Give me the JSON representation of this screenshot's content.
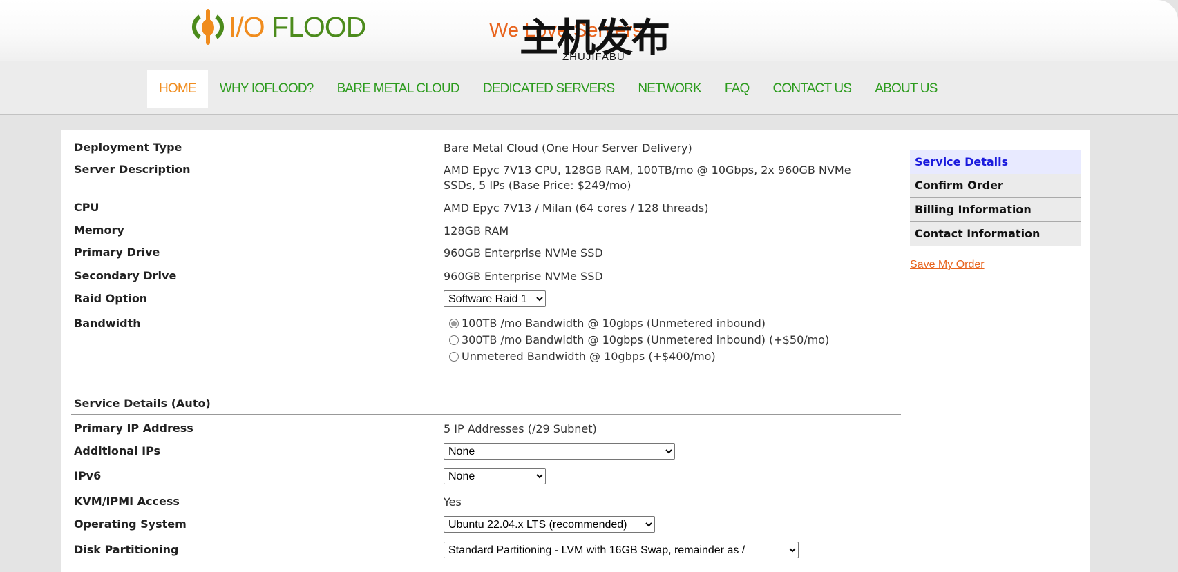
{
  "header": {
    "logo_text_io": "I/O",
    "logo_text_flood": " FLOOD",
    "tagline": "We Love Servers",
    "watermark_cn": "主机发布",
    "watermark_en": "ZHUJIFABU"
  },
  "nav": {
    "items": [
      "HOME",
      "WHY IOFLOOD?",
      "BARE METAL CLOUD",
      "DEDICATED SERVERS",
      "NETWORK",
      "FAQ",
      "CONTACT US",
      "ABOUT US"
    ],
    "active": "HOME"
  },
  "details": {
    "deployment_type": {
      "label": "Deployment Type",
      "value": "Bare Metal Cloud (One Hour Server Delivery)"
    },
    "server_description": {
      "label": "Server Description",
      "value": "AMD Epyc 7V13 CPU, 128GB RAM, 100TB/mo @ 10Gbps, 2x 960GB NVMe SSDs, 5 IPs (Base Price: $249/mo)"
    },
    "cpu": {
      "label": "CPU",
      "value": "AMD Epyc 7V13 / Milan (64 cores / 128 threads)"
    },
    "memory": {
      "label": "Memory",
      "value": "128GB RAM"
    },
    "primary_drive": {
      "label": "Primary Drive",
      "value": "960GB Enterprise NVMe SSD"
    },
    "secondary_drive": {
      "label": "Secondary Drive",
      "value": "960GB Enterprise NVMe SSD"
    },
    "raid_option": {
      "label": "Raid Option",
      "selected": "Software Raid 1"
    },
    "bandwidth": {
      "label": "Bandwidth",
      "options": [
        {
          "text": "100TB /mo Bandwidth @ 10gbps (Unmetered inbound)",
          "checked": true
        },
        {
          "text": "300TB /mo Bandwidth @ 10gbps (Unmetered inbound) (+$50/mo)",
          "checked": false
        },
        {
          "text": "Unmetered Bandwidth @ 10gbps (+$400/mo)",
          "checked": false
        }
      ]
    }
  },
  "service_auto": {
    "title": "Service Details (Auto)",
    "primary_ip": {
      "label": "Primary IP Address",
      "value": "5 IP Addresses (/29 Subnet)"
    },
    "additional_ips": {
      "label": "Additional IPs",
      "selected": "None"
    },
    "ipv6": {
      "label": "IPv6",
      "selected": "None"
    },
    "kvm": {
      "label": "KVM/IPMI Access",
      "value": "Yes"
    },
    "os": {
      "label": "Operating System",
      "selected": "Ubuntu 22.04.x LTS (recommended)"
    },
    "disk": {
      "label": "Disk Partitioning",
      "selected": "Standard Partitioning - LVM with 16GB Swap, remainder as /"
    }
  },
  "sidebar": {
    "items": [
      "Service Details",
      "Confirm Order",
      "Billing Information",
      "Contact Information"
    ],
    "active": "Service Details",
    "save_label": "Save My Order"
  },
  "colors": {
    "nav_green": "#2c9b1d",
    "accent_orange": "#f08c1e",
    "link_orange": "#e8641e",
    "sidebar_active": "#1a1add"
  }
}
